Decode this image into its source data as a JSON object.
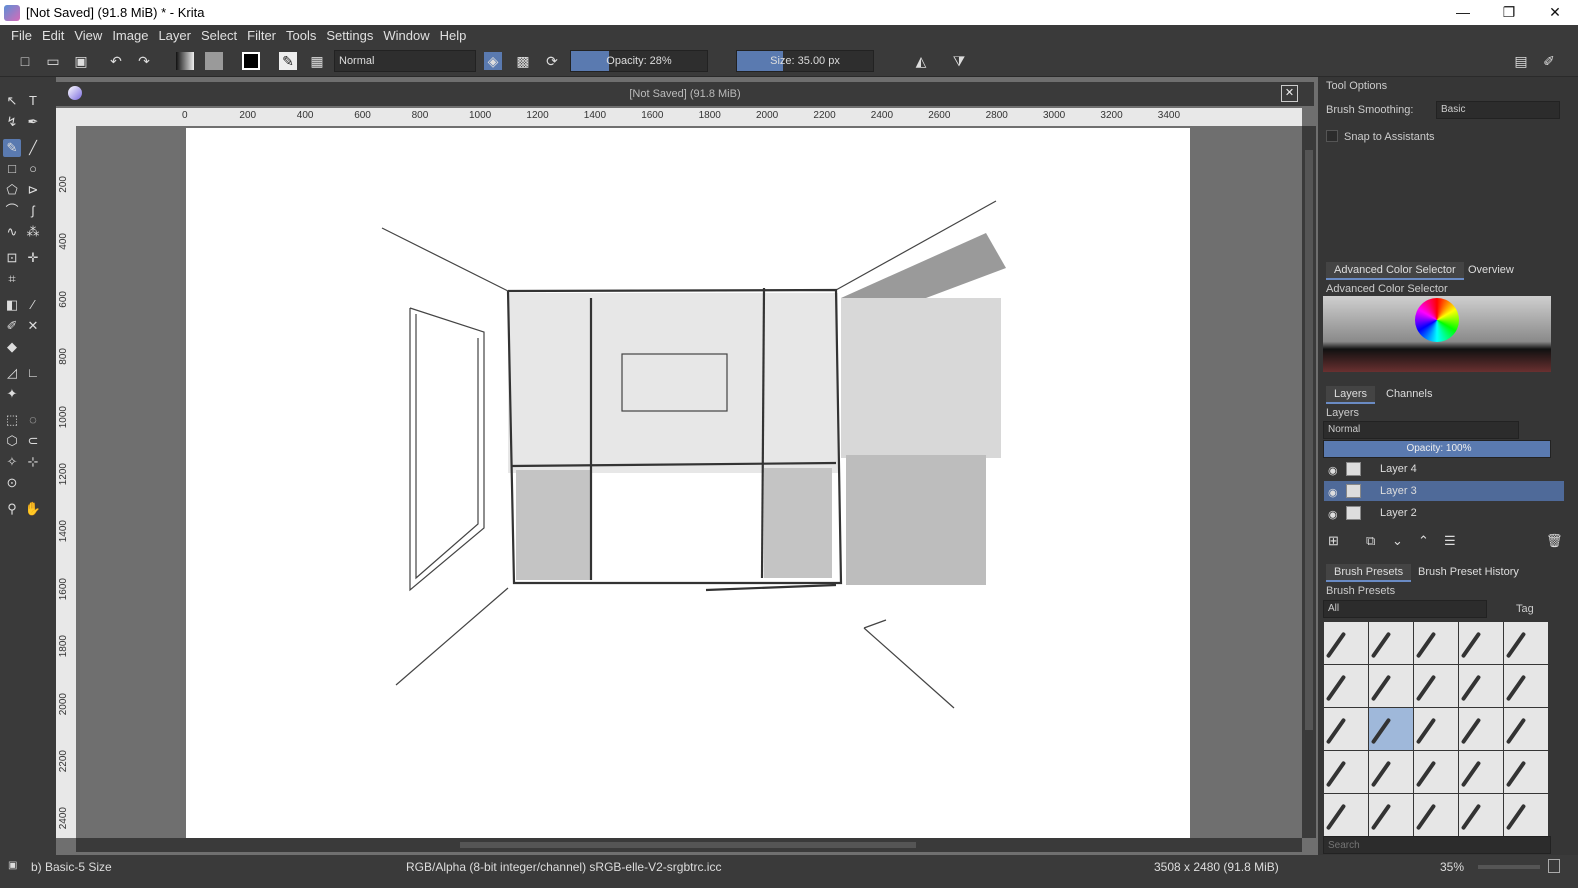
{
  "window": {
    "title": "[Not Saved]  (91.8 MiB) * - Krita",
    "controls": [
      "—",
      "❐",
      "✕"
    ]
  },
  "menu": [
    "File",
    "Edit",
    "View",
    "Image",
    "Layer",
    "Select",
    "Filter",
    "Tools",
    "Settings",
    "Window",
    "Help"
  ],
  "toolbar": {
    "blend_mode": "Normal",
    "opacity_label": "Opacity:  28%",
    "opacity_value": 0.28,
    "size_label": "Size:  35.00 px"
  },
  "document": {
    "tab_title": "[Not Saved]  (91.8 MiB)",
    "close": "✕"
  },
  "ruler": {
    "h_ticks": [
      "0",
      "200",
      "400",
      "600",
      "800",
      "1000",
      "1200",
      "1400",
      "1600",
      "1800",
      "2000",
      "2200",
      "2400",
      "2600",
      "2800",
      "3000",
      "3200",
      "3400"
    ],
    "v_ticks": [
      "200",
      "400",
      "600",
      "800",
      "1000",
      "1200",
      "1400",
      "1600",
      "1800",
      "2000",
      "2200",
      "2400"
    ]
  },
  "tool_options": {
    "title": "Tool Options",
    "brush_smoothing_label": "Brush Smoothing:",
    "brush_smoothing_value": "Basic",
    "snap_label": "Snap to Assistants"
  },
  "color_selector": {
    "tab_active": "Advanced Color Selector",
    "tab_other": "Overview",
    "header": "Advanced Color Selector"
  },
  "layers": {
    "tab_active": "Layers",
    "tab_other": "Channels",
    "header": "Layers",
    "blend_mode": "Normal",
    "opacity_label": "Opacity:  100%",
    "items": [
      {
        "name": "Layer 4",
        "selected": false
      },
      {
        "name": "Layer 3",
        "selected": true
      },
      {
        "name": "Layer 2",
        "selected": false
      }
    ]
  },
  "brush_presets": {
    "tab_active": "Brush Presets",
    "tab_other": "Brush Preset History",
    "header": "Brush Presets",
    "filter": "All",
    "tag_label": "Tag",
    "search_placeholder": "Search"
  },
  "status": {
    "brush": "b) Basic-5 Size",
    "color_space": "RGB/Alpha (8-bit integer/channel)  sRGB-elle-V2-srgbtrc.icc",
    "image_size": "3508 x 2480 (91.8 MiB)",
    "zoom": "35%"
  }
}
